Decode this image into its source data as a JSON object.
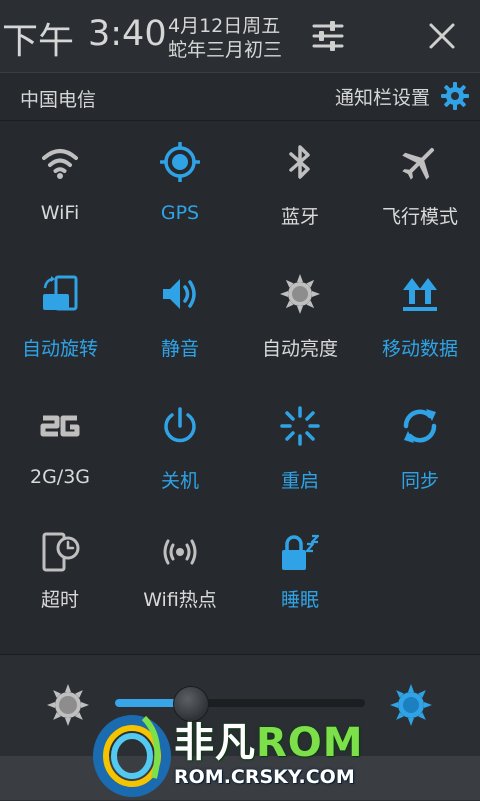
{
  "header": {
    "ampm": "下午",
    "time": "3:40",
    "date": "4月12日周五",
    "lunar_date": "蛇年三月初三",
    "settings_icon": "sliders-icon",
    "close_icon": "close-icon"
  },
  "carrier_row": {
    "carrier": "中国电信",
    "notification_settings": "通知栏设置",
    "settings_icon": "gear-icon"
  },
  "toggles": [
    {
      "label": "WiFi",
      "icon": "wifi-icon",
      "on": false
    },
    {
      "label": "GPS",
      "icon": "gps-icon",
      "on": true
    },
    {
      "label": "蓝牙",
      "icon": "bluetooth-icon",
      "on": false
    },
    {
      "label": "飞行模式",
      "icon": "airplane-icon",
      "on": false
    },
    {
      "label": "自动旋转",
      "icon": "auto-rotate-icon",
      "on": true
    },
    {
      "label": "静音",
      "icon": "speaker-icon",
      "on": true
    },
    {
      "label": "自动亮度",
      "icon": "auto-brightness-icon",
      "on": false
    },
    {
      "label": "移动数据",
      "icon": "mobile-data-icon",
      "on": true
    },
    {
      "label": "2G/3G",
      "icon": "network-2g-icon",
      "on": false
    },
    {
      "label": "关机",
      "icon": "power-icon",
      "on": true
    },
    {
      "label": "重启",
      "icon": "reboot-icon",
      "on": true
    },
    {
      "label": "同步",
      "icon": "sync-icon",
      "on": true
    },
    {
      "label": "超时",
      "icon": "screen-timeout-icon",
      "on": false
    },
    {
      "label": "Wifi热点",
      "icon": "wifi-hotspot-icon",
      "on": false
    },
    {
      "label": "睡眠",
      "icon": "sleep-lock-icon",
      "on": true
    }
  ],
  "brightness": {
    "level": 0.3,
    "min_icon": "brightness-low-icon",
    "max_icon": "brightness-high-icon"
  },
  "watermark": {
    "title_part1": "非凡",
    "title_part2": "ROM",
    "url": "ROM.CRSKY.COM"
  },
  "colors": {
    "accent": "#2fa3e6",
    "inactive": "#bfbfbf",
    "background": "#262a2e"
  }
}
